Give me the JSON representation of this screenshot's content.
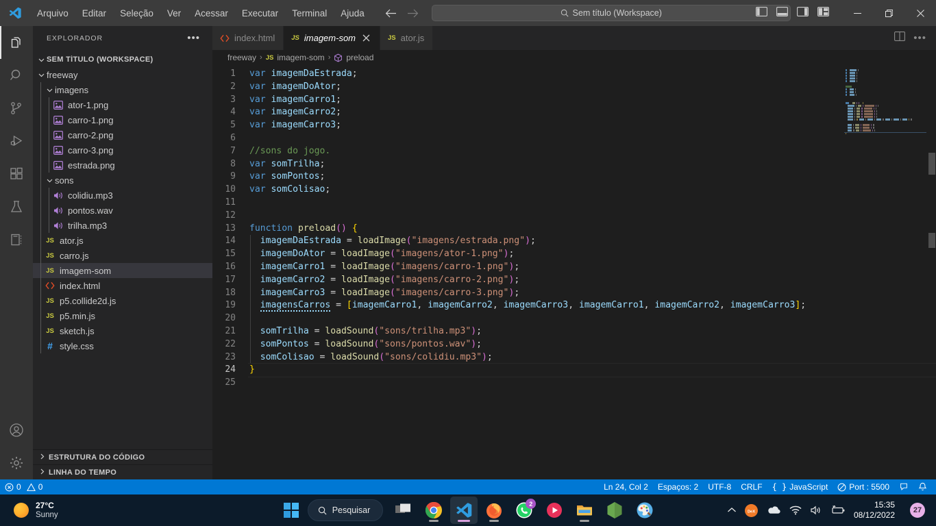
{
  "titlebar": {
    "menu": [
      "Arquivo",
      "Editar",
      "Seleção",
      "Ver",
      "Acessar",
      "Executar",
      "Terminal",
      "Ajuda"
    ],
    "quickpick_text": "Sem título (Workspace)"
  },
  "activitybar": {
    "items": [
      {
        "name": "explorer",
        "icon": "files-icon"
      },
      {
        "name": "search",
        "icon": "search-icon"
      },
      {
        "name": "source-control",
        "icon": "source-control-icon"
      },
      {
        "name": "run-and-debug",
        "icon": "run-debug-icon"
      },
      {
        "name": "extensions",
        "icon": "extensions-icon"
      },
      {
        "name": "testing",
        "icon": "beaker-icon"
      },
      {
        "name": "notebook",
        "icon": "notebook-icon"
      }
    ],
    "bottom": [
      {
        "name": "accounts",
        "icon": "account-icon"
      },
      {
        "name": "settings",
        "icon": "gear-icon"
      }
    ]
  },
  "sidebar": {
    "title": "EXPLORADOR",
    "root": "SEM TÍTULO (WORKSPACE)",
    "tree": [
      {
        "label": "freeway",
        "depth": 1,
        "type": "folder",
        "expanded": true
      },
      {
        "label": "imagens",
        "depth": 2,
        "type": "folder",
        "expanded": true
      },
      {
        "label": "ator-1.png",
        "depth": 3,
        "type": "image"
      },
      {
        "label": "carro-1.png",
        "depth": 3,
        "type": "image"
      },
      {
        "label": "carro-2.png",
        "depth": 3,
        "type": "image"
      },
      {
        "label": "carro-3.png",
        "depth": 3,
        "type": "image"
      },
      {
        "label": "estrada.png",
        "depth": 3,
        "type": "image"
      },
      {
        "label": "sons",
        "depth": 2,
        "type": "folder",
        "expanded": true
      },
      {
        "label": "colidiu.mp3",
        "depth": 3,
        "type": "audio"
      },
      {
        "label": "pontos.wav",
        "depth": 3,
        "type": "audio"
      },
      {
        "label": "trilha.mp3",
        "depth": 3,
        "type": "audio"
      },
      {
        "label": "ator.js",
        "depth": 2,
        "type": "js"
      },
      {
        "label": "carro.js",
        "depth": 2,
        "type": "js"
      },
      {
        "label": "imagem-som",
        "depth": 2,
        "type": "js",
        "selected": true
      },
      {
        "label": "index.html",
        "depth": 2,
        "type": "html"
      },
      {
        "label": "p5.collide2d.js",
        "depth": 2,
        "type": "js"
      },
      {
        "label": "p5.min.js",
        "depth": 2,
        "type": "js"
      },
      {
        "label": "sketch.js",
        "depth": 2,
        "type": "js"
      },
      {
        "label": "style.css",
        "depth": 2,
        "type": "css"
      }
    ],
    "sections": [
      "ESTRUTURA DO CÓDIGO",
      "LINHA DO TEMPO"
    ]
  },
  "editor": {
    "tabs": [
      {
        "label": "index.html",
        "type": "html",
        "active": false,
        "closable": false
      },
      {
        "label": "imagem-som",
        "type": "js",
        "active": true,
        "closable": true
      },
      {
        "label": "ator.js",
        "type": "js",
        "active": false,
        "closable": false
      }
    ],
    "breadcrumb": [
      {
        "label": "freeway",
        "icon": ""
      },
      {
        "label": "imagem-som",
        "icon": "js-icon"
      },
      {
        "label": "preload",
        "icon": "symbol-method-icon"
      }
    ],
    "code": [
      {
        "n": 1,
        "tokens": [
          {
            "t": "var",
            "c": "kw"
          },
          {
            "t": " ",
            "c": "pun"
          },
          {
            "t": "imagemDaEstrada",
            "c": "var"
          },
          {
            "t": ";",
            "c": "pun"
          }
        ]
      },
      {
        "n": 2,
        "tokens": [
          {
            "t": "var",
            "c": "kw"
          },
          {
            "t": " ",
            "c": "pun"
          },
          {
            "t": "imagemDoAtor",
            "c": "var"
          },
          {
            "t": ";",
            "c": "pun"
          }
        ]
      },
      {
        "n": 3,
        "tokens": [
          {
            "t": "var",
            "c": "kw"
          },
          {
            "t": " ",
            "c": "pun"
          },
          {
            "t": "imagemCarro1",
            "c": "var"
          },
          {
            "t": ";",
            "c": "pun"
          }
        ]
      },
      {
        "n": 4,
        "tokens": [
          {
            "t": "var",
            "c": "kw"
          },
          {
            "t": " ",
            "c": "pun"
          },
          {
            "t": "imagemCarro2",
            "c": "var"
          },
          {
            "t": ";",
            "c": "pun"
          }
        ]
      },
      {
        "n": 5,
        "tokens": [
          {
            "t": "var",
            "c": "kw"
          },
          {
            "t": " ",
            "c": "pun"
          },
          {
            "t": "imagemCarro3",
            "c": "var"
          },
          {
            "t": ";",
            "c": "pun"
          }
        ]
      },
      {
        "n": 6,
        "tokens": []
      },
      {
        "n": 7,
        "tokens": [
          {
            "t": "//sons do jogo.",
            "c": "cmt"
          }
        ]
      },
      {
        "n": 8,
        "tokens": [
          {
            "t": "var",
            "c": "kw"
          },
          {
            "t": " ",
            "c": "pun"
          },
          {
            "t": "somTrilha",
            "c": "var"
          },
          {
            "t": ";",
            "c": "pun"
          }
        ]
      },
      {
        "n": 9,
        "tokens": [
          {
            "t": "var",
            "c": "kw"
          },
          {
            "t": " ",
            "c": "pun"
          },
          {
            "t": "somPontos",
            "c": "var"
          },
          {
            "t": ";",
            "c": "pun"
          }
        ]
      },
      {
        "n": 10,
        "tokens": [
          {
            "t": "var",
            "c": "kw"
          },
          {
            "t": " ",
            "c": "pun"
          },
          {
            "t": "somColisao",
            "c": "var"
          },
          {
            "t": ";",
            "c": "pun"
          }
        ]
      },
      {
        "n": 11,
        "tokens": []
      },
      {
        "n": 12,
        "tokens": []
      },
      {
        "n": 13,
        "tokens": [
          {
            "t": "function",
            "c": "fnkw"
          },
          {
            "t": " ",
            "c": "pun"
          },
          {
            "t": "preload",
            "c": "fn"
          },
          {
            "t": "(",
            "c": "paren"
          },
          {
            "t": ")",
            "c": "paren"
          },
          {
            "t": " ",
            "c": "pun"
          },
          {
            "t": "{",
            "c": "brc"
          }
        ]
      },
      {
        "n": 14,
        "tokens": [
          {
            "t": "  ",
            "c": "pun"
          },
          {
            "t": "imagemDaEstrada",
            "c": "var"
          },
          {
            "t": " = ",
            "c": "pun"
          },
          {
            "t": "loadImage",
            "c": "fn"
          },
          {
            "t": "(",
            "c": "paren"
          },
          {
            "t": "\"imagens/estrada.png\"",
            "c": "str"
          },
          {
            "t": ")",
            "c": "paren"
          },
          {
            "t": ";",
            "c": "pun"
          }
        ]
      },
      {
        "n": 15,
        "tokens": [
          {
            "t": "  ",
            "c": "pun"
          },
          {
            "t": "imagemDoAtor",
            "c": "var"
          },
          {
            "t": " = ",
            "c": "pun"
          },
          {
            "t": "loadImage",
            "c": "fn"
          },
          {
            "t": "(",
            "c": "paren"
          },
          {
            "t": "\"imagens/ator-1.png\"",
            "c": "str"
          },
          {
            "t": ")",
            "c": "paren"
          },
          {
            "t": ";",
            "c": "pun"
          }
        ]
      },
      {
        "n": 16,
        "tokens": [
          {
            "t": "  ",
            "c": "pun"
          },
          {
            "t": "imagemCarro1",
            "c": "var"
          },
          {
            "t": " = ",
            "c": "pun"
          },
          {
            "t": "loadImage",
            "c": "fn"
          },
          {
            "t": "(",
            "c": "paren"
          },
          {
            "t": "\"imagens/carro-1.png\"",
            "c": "str"
          },
          {
            "t": ")",
            "c": "paren"
          },
          {
            "t": ";",
            "c": "pun"
          }
        ]
      },
      {
        "n": 17,
        "tokens": [
          {
            "t": "  ",
            "c": "pun"
          },
          {
            "t": "imagemCarro2",
            "c": "var"
          },
          {
            "t": " = ",
            "c": "pun"
          },
          {
            "t": "loadImage",
            "c": "fn"
          },
          {
            "t": "(",
            "c": "paren"
          },
          {
            "t": "\"imagens/carro-2.png\"",
            "c": "str"
          },
          {
            "t": ")",
            "c": "paren"
          },
          {
            "t": ";",
            "c": "pun"
          }
        ]
      },
      {
        "n": 18,
        "tokens": [
          {
            "t": "  ",
            "c": "pun"
          },
          {
            "t": "imagemCarro3",
            "c": "var"
          },
          {
            "t": " = ",
            "c": "pun"
          },
          {
            "t": "loadImage",
            "c": "fn"
          },
          {
            "t": "(",
            "c": "paren"
          },
          {
            "t": "\"imagens/carro-3.png\"",
            "c": "str"
          },
          {
            "t": ")",
            "c": "paren"
          },
          {
            "t": ";",
            "c": "pun"
          }
        ]
      },
      {
        "n": 19,
        "tokens": [
          {
            "t": "  ",
            "c": "pun"
          },
          {
            "t": "imagensCarros",
            "c": "var squiggle"
          },
          {
            "t": " = ",
            "c": "pun"
          },
          {
            "t": "[",
            "c": "brk"
          },
          {
            "t": "imagemCarro1",
            "c": "var"
          },
          {
            "t": ", ",
            "c": "pun"
          },
          {
            "t": "imagemCarro2",
            "c": "var"
          },
          {
            "t": ", ",
            "c": "pun"
          },
          {
            "t": "imagemCarro3",
            "c": "var"
          },
          {
            "t": ", ",
            "c": "pun"
          },
          {
            "t": "imagemCarro1",
            "c": "var"
          },
          {
            "t": ", ",
            "c": "pun"
          },
          {
            "t": "imagemCarro2",
            "c": "var"
          },
          {
            "t": ", ",
            "c": "pun"
          },
          {
            "t": "imagemCarro3",
            "c": "var"
          },
          {
            "t": "]",
            "c": "brk"
          },
          {
            "t": ";",
            "c": "pun"
          }
        ]
      },
      {
        "n": 20,
        "tokens": []
      },
      {
        "n": 21,
        "tokens": [
          {
            "t": "  ",
            "c": "pun"
          },
          {
            "t": "somTrilha",
            "c": "var"
          },
          {
            "t": " = ",
            "c": "pun"
          },
          {
            "t": "loadSound",
            "c": "fn"
          },
          {
            "t": "(",
            "c": "paren"
          },
          {
            "t": "\"sons/trilha.mp3\"",
            "c": "str"
          },
          {
            "t": ")",
            "c": "paren"
          },
          {
            "t": ";",
            "c": "pun"
          }
        ]
      },
      {
        "n": 22,
        "tokens": [
          {
            "t": "  ",
            "c": "pun"
          },
          {
            "t": "somPontos",
            "c": "var"
          },
          {
            "t": " = ",
            "c": "pun"
          },
          {
            "t": "loadSound",
            "c": "fn"
          },
          {
            "t": "(",
            "c": "paren"
          },
          {
            "t": "\"sons/pontos.wav\"",
            "c": "str"
          },
          {
            "t": ")",
            "c": "paren"
          },
          {
            "t": ";",
            "c": "pun"
          }
        ]
      },
      {
        "n": 23,
        "tokens": [
          {
            "t": "  ",
            "c": "pun"
          },
          {
            "t": "somColisao",
            "c": "var"
          },
          {
            "t": " = ",
            "c": "pun"
          },
          {
            "t": "loadSound",
            "c": "fn"
          },
          {
            "t": "(",
            "c": "paren"
          },
          {
            "t": "\"sons/colidiu.mp3\"",
            "c": "str"
          },
          {
            "t": ")",
            "c": "paren"
          },
          {
            "t": ";",
            "c": "pun"
          }
        ]
      },
      {
        "n": 24,
        "tokens": [
          {
            "t": "}",
            "c": "brc"
          }
        ],
        "current": true
      },
      {
        "n": 25,
        "tokens": []
      }
    ]
  },
  "statusbar": {
    "errors": "0",
    "warnings": "0",
    "position": "Ln 24, Col 2",
    "spaces": "Espaços: 2",
    "encoding": "UTF-8",
    "eol": "CRLF",
    "language": "JavaScript",
    "port": "Port : 5500"
  },
  "taskbar": {
    "weather_temp": "27°C",
    "weather_cond": "Sunny",
    "search_label": "Pesquisar",
    "apps": [
      {
        "name": "start-button",
        "icon": "windows-logo"
      },
      {
        "name": "task-view",
        "icon": "task-view-icon"
      },
      {
        "name": "google-chrome",
        "icon": "chrome-icon"
      },
      {
        "name": "visual-studio-code",
        "icon": "vscode-icon"
      },
      {
        "name": "firefox",
        "icon": "firefox-icon"
      },
      {
        "name": "whatsapp",
        "icon": "whatsapp-icon",
        "badge": "2"
      },
      {
        "name": "media-player",
        "icon": "play-icon"
      },
      {
        "name": "file-explorer",
        "icon": "folder-icon"
      },
      {
        "name": "node-js",
        "icon": "nodejs-icon"
      },
      {
        "name": "paint",
        "icon": "paint-icon"
      }
    ],
    "tray": [
      "chevron-up-icon",
      "dex-icon",
      "onedrive-icon",
      "wifi-icon",
      "volume-icon",
      "battery-icon"
    ],
    "time": "15:35",
    "date": "08/12/2022",
    "notif_badge": "27"
  },
  "chart_data": null
}
